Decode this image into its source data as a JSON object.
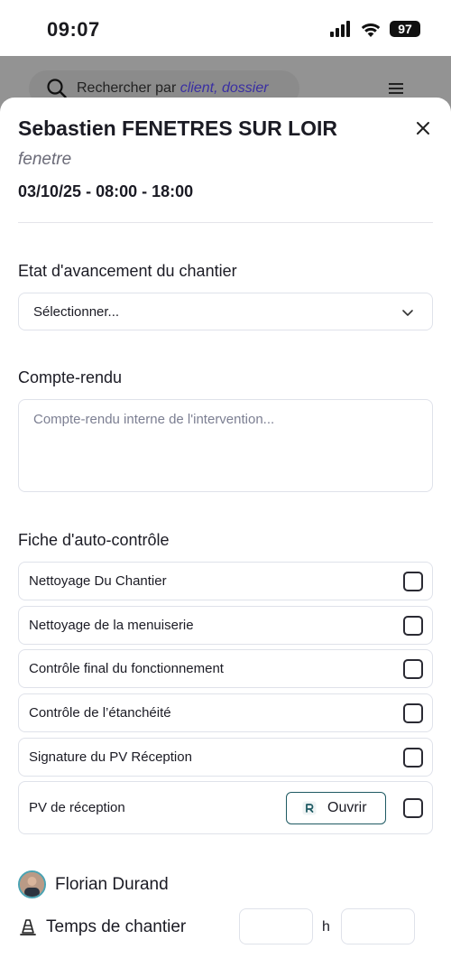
{
  "status_bar": {
    "time": "09:07",
    "battery": "97"
  },
  "background": {
    "search_prefix": "Rechercher par ",
    "search_emphasis": "client, dossier"
  },
  "sheet": {
    "title": "Sebastien FENETRES SUR LOIR",
    "subtitle": "fenetre",
    "datetime": "03/10/25 - 08:00 - 18:00",
    "progress_section": {
      "label": "Etat d'avancement du chantier",
      "select_value": "Sélectionner..."
    },
    "report_section": {
      "label": "Compte-rendu",
      "placeholder": "Compte-rendu interne de l'intervention..."
    },
    "checklist": {
      "label": "Fiche d'auto-contrôle",
      "items": [
        {
          "label": "Nettoyage Du Chantier",
          "checked": false
        },
        {
          "label": "Nettoyage de la menuiserie",
          "checked": false
        },
        {
          "label": "Contrôle final du fonctionnement",
          "checked": false
        },
        {
          "label": "Contrôle de l’étanchéité",
          "checked": false
        },
        {
          "label": "Signature du PV Réception",
          "checked": false
        },
        {
          "label": "PV de réception",
          "checked": false,
          "button_label": "Ouvrir"
        }
      ]
    },
    "technician": {
      "name": "Florian Durand"
    },
    "site_time": {
      "label": "Temps de chantier",
      "hours_separator": "h"
    }
  },
  "colors": {
    "accent": "#1f5a63",
    "avatar_ring": "#4aa3b3",
    "border": "#dfe2ea"
  }
}
